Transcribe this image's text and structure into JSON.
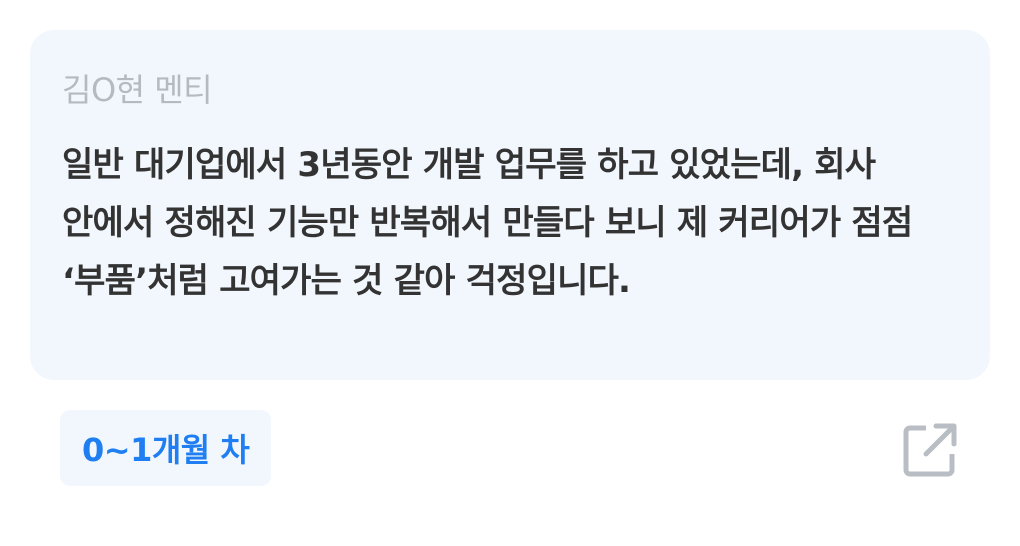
{
  "card": {
    "mentee_name": "김O현 멘티",
    "question_text": "일반 대기업에서 3년동안 개발 업무를 하고 있었는데, 회사 안에서 정해진 기능만 반복해서 만들다 보니 제 커리어가 점점 ‘부품’처럼 고여가는 것 같아 걱정입니다."
  },
  "footer": {
    "career_badge": "0~1개월 차",
    "open_link_icon": "external-link-icon"
  },
  "colors": {
    "card_background": "#f2f7fd",
    "accent": "#1e7ef2",
    "muted_text": "#b4bac1",
    "body_text": "#333333",
    "icon": "#b9bec4"
  }
}
